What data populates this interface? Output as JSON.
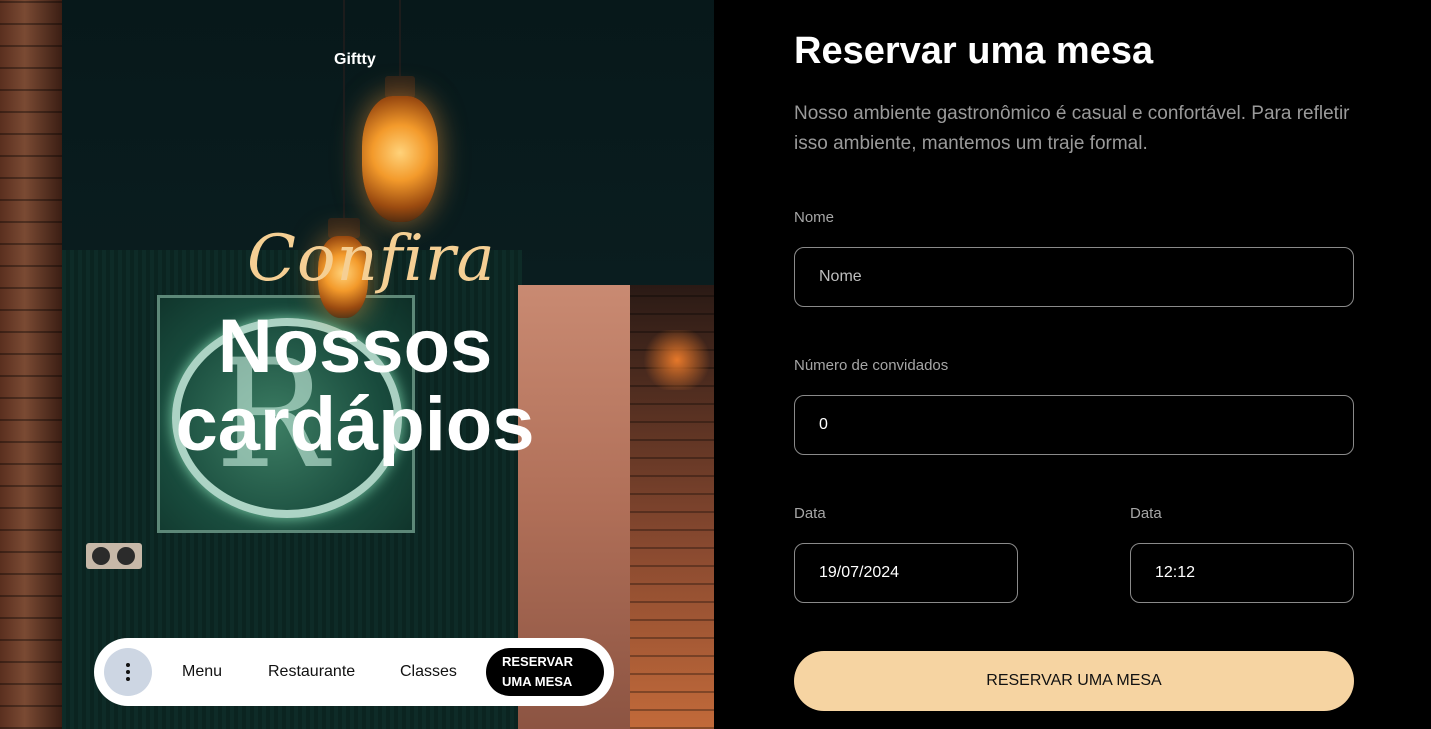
{
  "hero": {
    "brand": "Giftty",
    "script_title": "Confira",
    "title_line1": "Nossos",
    "title_line2": "cardápios"
  },
  "nav": {
    "more_icon": "kebab-vertical-icon",
    "items": [
      {
        "label": "Menu"
      },
      {
        "label": "Restaurante"
      },
      {
        "label": "Classes"
      }
    ],
    "cta_line1": "RESERVAR",
    "cta_line2": "UMA MESA"
  },
  "form": {
    "title": "Reservar uma mesa",
    "description": "Nosso ambiente gastronômico é casual e confortável. Para refletir isso ambiente, mantemos um traje formal.",
    "name_label": "Nome",
    "name_placeholder": "Nome",
    "name_value": "",
    "guests_label": "Número de convidados",
    "guests_value": "0",
    "date_label": "Data",
    "date_value": "19/07/2024",
    "time_label": "Data",
    "time_value": "12:12",
    "submit_label": "RESERVAR UMA MESA"
  },
  "colors": {
    "accent": "#f6d4a2",
    "script": "#f5cf94",
    "panel_bg": "#000000",
    "nav_bg": "#ffffff"
  }
}
